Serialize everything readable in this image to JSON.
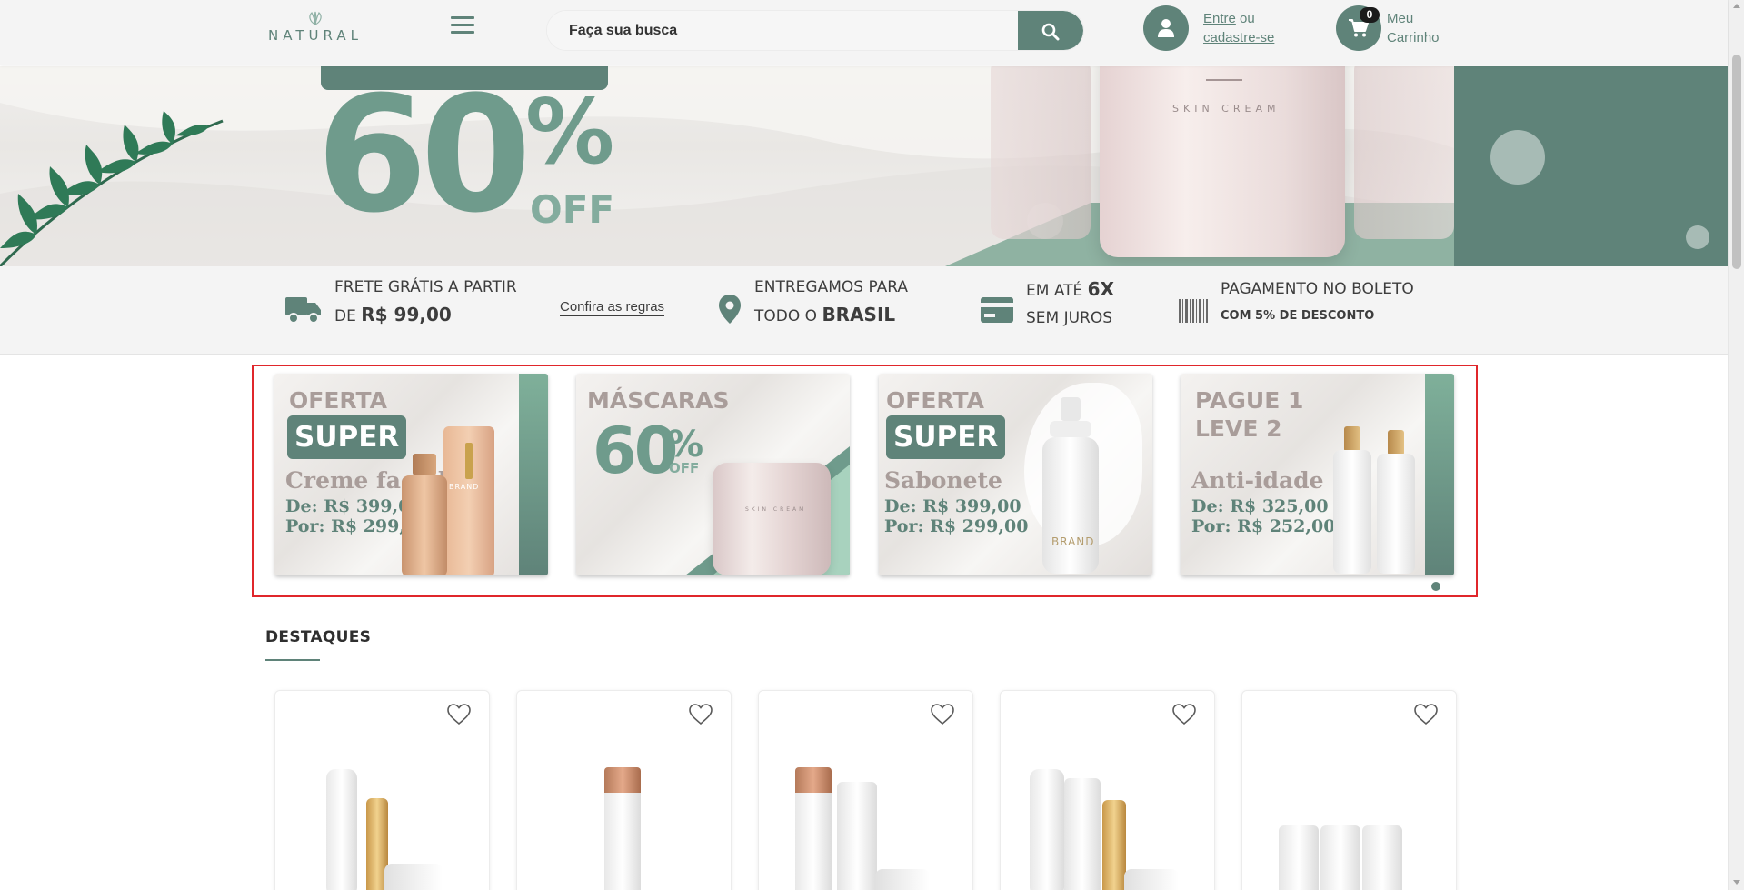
{
  "header": {
    "logo_text": "NATURAL",
    "search_placeholder": "Faça sua busca",
    "account": {
      "login_link": "Entre",
      "or_text": "ou",
      "register_link": "cadastre-se"
    },
    "cart": {
      "count": "0",
      "line1": "Meu",
      "line2": "Carrinho"
    }
  },
  "hero": {
    "big": "60",
    "percent": "%",
    "off": "OFF",
    "product_label": "SKIN CREAM"
  },
  "benefits": {
    "shipping": {
      "line1": "FRETE GRÁTIS A PARTIR",
      "line2_prefix": "DE",
      "line2_value": "R$ 99,00",
      "rules_link": "Confira as regras"
    },
    "delivery": {
      "line1": "ENTREGAMOS PARA",
      "line2_prefix": "TODO O",
      "line2_value": "BRASIL"
    },
    "installments": {
      "line1_prefix": "EM ATÉ",
      "line1_value": "6X",
      "line2": "SEM JUROS"
    },
    "boleto": {
      "line1": "PAGAMENTO NO BOLETO",
      "line2": "COM 5% DE DESCONTO"
    }
  },
  "promos": [
    {
      "title": "OFERTA",
      "pill": "SUPER",
      "product": "Creme facial",
      "price_from": "De: R$ 399,00",
      "price_to": "Por: R$ 299,00",
      "brand": "BRAND"
    },
    {
      "title": "MÁSCARAS",
      "pct": "60",
      "pct_sign": "%",
      "off": "OFF",
      "jar_label": "SKIN CREAM"
    },
    {
      "title": "OFERTA",
      "pill": "SUPER",
      "product": "Sabonete",
      "price_from": "De: R$ 399,00",
      "price_to": "Por: R$ 299,00",
      "brand": "BRAND"
    },
    {
      "title_line1": "PAGUE 1",
      "title_line2": "LEVE 2",
      "product": "Anti-idade",
      "price_from": "De: R$ 325,00",
      "price_to": "Por: R$ 252,00"
    }
  ],
  "section": {
    "title": "DESTAQUES"
  },
  "colors": {
    "primary": "#5f8379",
    "accent_light": "#83ac9e",
    "promo_text": "#a99d9a",
    "highlight_border": "#e0262b"
  },
  "icons": [
    "leaf-logo-icon",
    "hamburger-menu-icon",
    "search-icon",
    "user-icon",
    "cart-icon",
    "truck-icon",
    "map-pin-icon",
    "credit-card-icon",
    "barcode-icon",
    "heart-icon"
  ]
}
